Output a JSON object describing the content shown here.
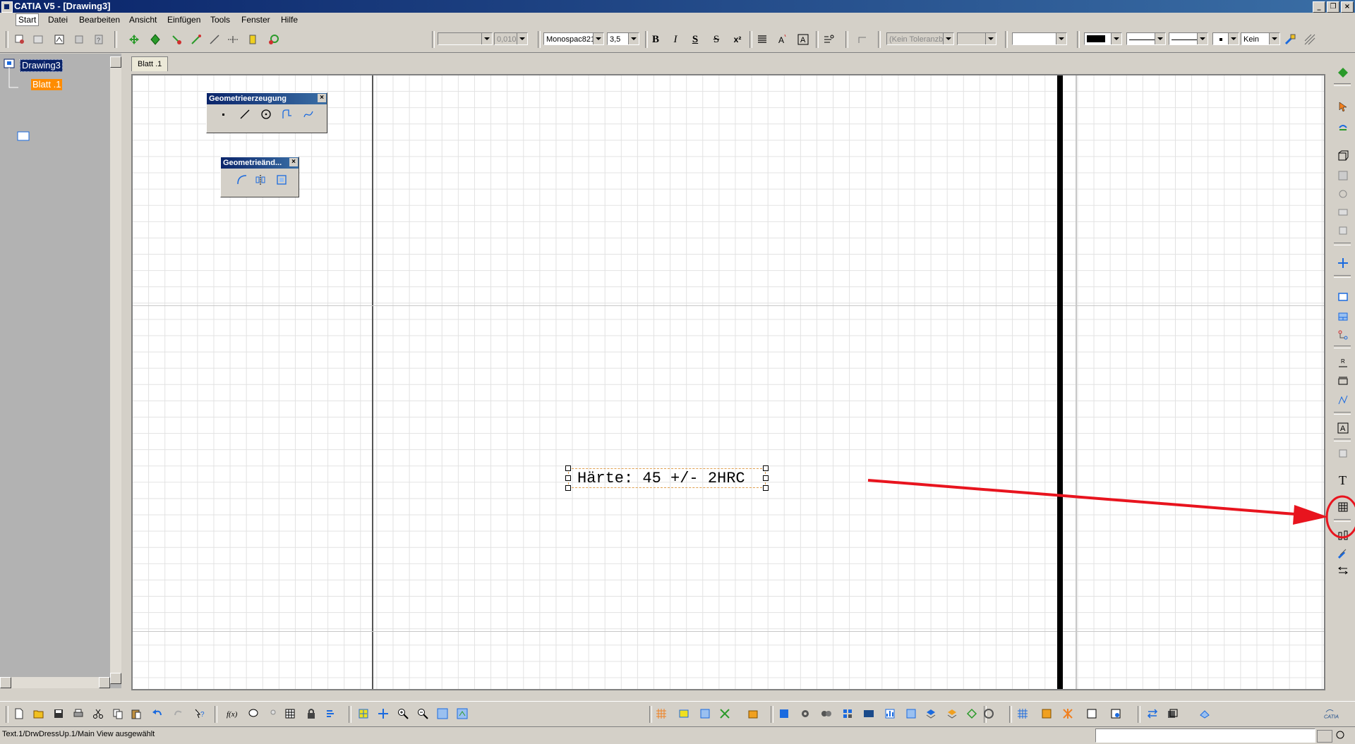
{
  "window": {
    "title": "CATIA V5 - [Drawing3]"
  },
  "menu": {
    "items": [
      "Start",
      "Datei",
      "Bearbeiten",
      "Ansicht",
      "Einfügen",
      "Tools",
      "Fenster",
      "Hilfe"
    ]
  },
  "toolbar": {
    "scale_value": "0,010",
    "font_name": "Monospac821",
    "font_size": "3,5",
    "bold": "B",
    "italic": "I",
    "underline": "S",
    "strike": "S",
    "superscript": "x²",
    "tolerance": "(Kein Toleranzb",
    "fill_none": "Kein"
  },
  "tree": {
    "root": "Drawing3",
    "child": "Blatt .1"
  },
  "tabs": {
    "sheet": "Blatt .1"
  },
  "floating": {
    "geometry_creation": "Geometrieerzeugung",
    "geometry_modification": "Geometrieänd..."
  },
  "drawing": {
    "text": "Härte: 45 +/- 2HRC"
  },
  "status": {
    "message": "Text.1/DrwDressUp.1/Main View ausgewählt"
  },
  "colors": {
    "annotation": "#e8141e",
    "selection": "#0a246a",
    "tree_child": "#ff8c00"
  }
}
